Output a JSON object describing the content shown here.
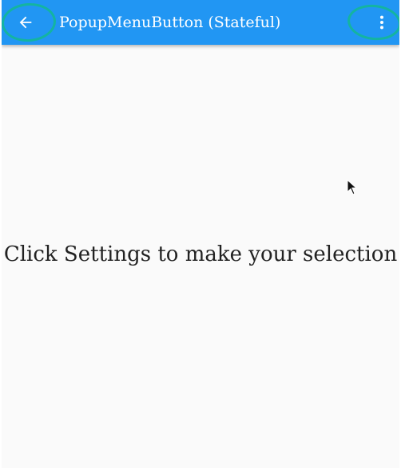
{
  "app_bar": {
    "title": "PopupMenuButton (Stateful)",
    "back_icon": "arrow-left-icon",
    "more_icon": "more-vert-icon",
    "background_color": "#2196f3",
    "foreground_color": "#ffffff"
  },
  "content": {
    "message": "Click Settings to make your selection",
    "background_color": "#fafafa"
  },
  "annotations": {
    "highlight_color": "#14b4a0"
  }
}
